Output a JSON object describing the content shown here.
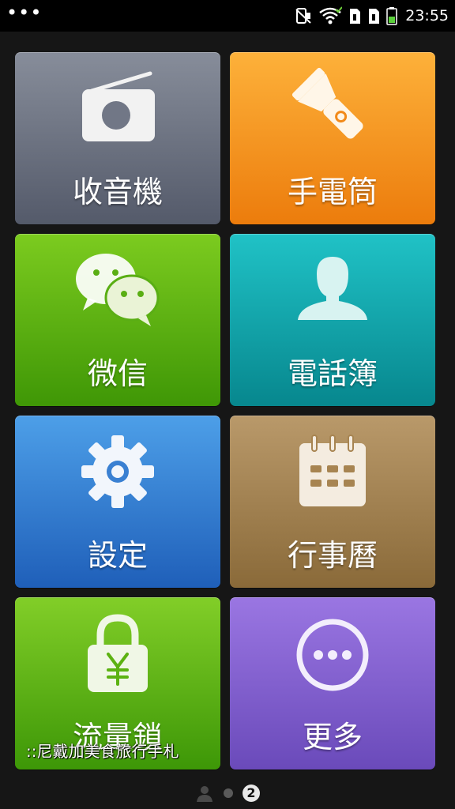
{
  "status_bar": {
    "menu_dots": "•••",
    "time": "23:55",
    "icons": [
      "silent-mode-icon",
      "wifi-icon",
      "sim-card-1-icon",
      "sim-card-2-icon",
      "battery-icon"
    ]
  },
  "tiles": [
    {
      "label": "收音機",
      "icon": "radio-icon",
      "color": "#6f7584"
    },
    {
      "label": "手電筒",
      "icon": "flashlight-icon",
      "color": "#f69a22"
    },
    {
      "label": "微信",
      "icon": "wechat-icon",
      "color": "#5cb212"
    },
    {
      "label": "電話簿",
      "icon": "contact-person-icon",
      "color": "#11a6ab"
    },
    {
      "label": "設定",
      "icon": "gear-icon",
      "color": "#3a80d2"
    },
    {
      "label": "行事曆",
      "icon": "calendar-icon",
      "color": "#a78451"
    },
    {
      "label": "流量鎖",
      "icon": "padlock-yen-icon",
      "color": "#62b618"
    },
    {
      "label": "更多",
      "icon": "more-dots-icon",
      "color": "#8260d0"
    }
  ],
  "watermark": "::尼戴加美食旅行手札",
  "page_indicator": {
    "current_page": "2"
  }
}
